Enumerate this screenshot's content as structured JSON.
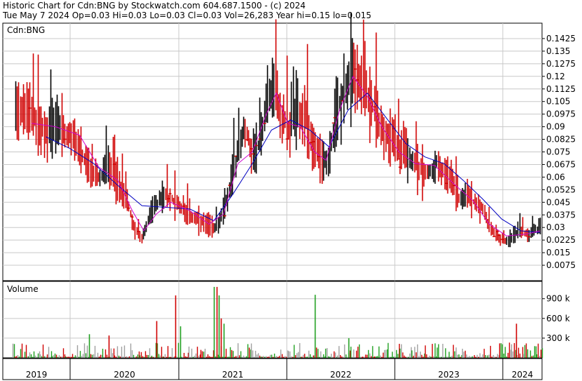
{
  "header": {
    "line1": "Historic Chart for Cdn:BNG by Stockwatch.com 604.687.1500 - (c) 2024",
    "line2": "Tue May  7 2024  Op=0.03  Hi=0.03  Lo=0.03  Cl=0.03  Vol=26,283  Year hi=0.15  lo=0.015"
  },
  "chart_data": [
    {
      "type": "bar",
      "title": "Cdn:BNG",
      "subtype": "price-range-bars-with-moving-averages",
      "x_categories": [
        "2019",
        "2020",
        "2021",
        "2022",
        "2023",
        "2024"
      ],
      "ylim": [
        0,
        0.15
      ],
      "y_ticks": [
        "0.0075",
        "0.015",
        "0.0225",
        "0.03",
        "0.0375",
        "0.045",
        "0.0525",
        "0.06",
        "0.0675",
        "0.075",
        "0.0825",
        "0.09",
        "0.0975",
        "0.105",
        "0.1125",
        "0.12",
        "0.1275",
        "0.135",
        "0.1425"
      ],
      "grid": true,
      "price_path": [
        {
          "t": 2018.88,
          "p": 0.105
        },
        {
          "t": 2019.05,
          "p": 0.095
        },
        {
          "t": 2019.2,
          "p": 0.088
        },
        {
          "t": 2019.35,
          "p": 0.09
        },
        {
          "t": 2019.5,
          "p": 0.082
        },
        {
          "t": 2019.6,
          "p": 0.07
        },
        {
          "t": 2019.75,
          "p": 0.06
        },
        {
          "t": 2019.85,
          "p": 0.065
        },
        {
          "t": 2019.97,
          "p": 0.055
        },
        {
          "t": 2020.05,
          "p": 0.045
        },
        {
          "t": 2020.12,
          "p": 0.028
        },
        {
          "t": 2020.2,
          "p": 0.024
        },
        {
          "t": 2020.3,
          "p": 0.04
        },
        {
          "t": 2020.42,
          "p": 0.05
        },
        {
          "t": 2020.55,
          "p": 0.045
        },
        {
          "t": 2020.65,
          "p": 0.04
        },
        {
          "t": 2020.75,
          "p": 0.035
        },
        {
          "t": 2020.85,
          "p": 0.032
        },
        {
          "t": 2020.95,
          "p": 0.03
        },
        {
          "t": 2021.02,
          "p": 0.035
        },
        {
          "t": 2021.1,
          "p": 0.05
        },
        {
          "t": 2021.18,
          "p": 0.07
        },
        {
          "t": 2021.26,
          "p": 0.09
        },
        {
          "t": 2021.34,
          "p": 0.075
        },
        {
          "t": 2021.42,
          "p": 0.08
        },
        {
          "t": 2021.5,
          "p": 0.105
        },
        {
          "t": 2021.58,
          "p": 0.115
        },
        {
          "t": 2021.66,
          "p": 0.095
        },
        {
          "t": 2021.74,
          "p": 0.088
        },
        {
          "t": 2021.82,
          "p": 0.098
        },
        {
          "t": 2021.9,
          "p": 0.095
        },
        {
          "t": 2021.98,
          "p": 0.08
        },
        {
          "t": 2022.06,
          "p": 0.068
        },
        {
          "t": 2022.14,
          "p": 0.07
        },
        {
          "t": 2022.22,
          "p": 0.1
        },
        {
          "t": 2022.3,
          "p": 0.11
        },
        {
          "t": 2022.38,
          "p": 0.125
        },
        {
          "t": 2022.46,
          "p": 0.118
        },
        {
          "t": 2022.54,
          "p": 0.11
        },
        {
          "t": 2022.62,
          "p": 0.1
        },
        {
          "t": 2022.7,
          "p": 0.09
        },
        {
          "t": 2022.78,
          "p": 0.085
        },
        {
          "t": 2022.86,
          "p": 0.078
        },
        {
          "t": 2022.94,
          "p": 0.068
        },
        {
          "t": 2023.02,
          "p": 0.07
        },
        {
          "t": 2023.1,
          "p": 0.065
        },
        {
          "t": 2023.18,
          "p": 0.062
        },
        {
          "t": 2023.26,
          "p": 0.068
        },
        {
          "t": 2023.34,
          "p": 0.064
        },
        {
          "t": 2023.42,
          "p": 0.058
        },
        {
          "t": 2023.5,
          "p": 0.048
        },
        {
          "t": 2023.58,
          "p": 0.05
        },
        {
          "t": 2023.66,
          "p": 0.045
        },
        {
          "t": 2023.74,
          "p": 0.042
        },
        {
          "t": 2023.82,
          "p": 0.03
        },
        {
          "t": 2023.9,
          "p": 0.025
        },
        {
          "t": 2023.98,
          "p": 0.022
        },
        {
          "t": 2024.06,
          "p": 0.025
        },
        {
          "t": 2024.14,
          "p": 0.028
        },
        {
          "t": 2024.22,
          "p": 0.025
        },
        {
          "t": 2024.3,
          "p": 0.028
        },
        {
          "t": 2024.35,
          "p": 0.03
        }
      ],
      "ma_short": [
        {
          "t": 2019.05,
          "p": 0.092
        },
        {
          "t": 2019.3,
          "p": 0.09
        },
        {
          "t": 2019.55,
          "p": 0.085
        },
        {
          "t": 2019.75,
          "p": 0.066
        },
        {
          "t": 2019.95,
          "p": 0.058
        },
        {
          "t": 2020.1,
          "p": 0.04
        },
        {
          "t": 2020.22,
          "p": 0.028
        },
        {
          "t": 2020.35,
          "p": 0.038
        },
        {
          "t": 2020.5,
          "p": 0.045
        },
        {
          "t": 2020.7,
          "p": 0.04
        },
        {
          "t": 2020.9,
          "p": 0.032
        },
        {
          "t": 2021.05,
          "p": 0.038
        },
        {
          "t": 2021.2,
          "p": 0.068
        },
        {
          "t": 2021.35,
          "p": 0.075
        },
        {
          "t": 2021.5,
          "p": 0.098
        },
        {
          "t": 2021.6,
          "p": 0.11
        },
        {
          "t": 2021.72,
          "p": 0.092
        },
        {
          "t": 2021.85,
          "p": 0.09
        },
        {
          "t": 2022.0,
          "p": 0.075
        },
        {
          "t": 2022.12,
          "p": 0.07
        },
        {
          "t": 2022.26,
          "p": 0.1
        },
        {
          "t": 2022.4,
          "p": 0.12
        },
        {
          "t": 2022.55,
          "p": 0.108
        },
        {
          "t": 2022.7,
          "p": 0.09
        },
        {
          "t": 2022.88,
          "p": 0.075
        },
        {
          "t": 2023.05,
          "p": 0.068
        },
        {
          "t": 2023.25,
          "p": 0.067
        },
        {
          "t": 2023.45,
          "p": 0.056
        },
        {
          "t": 2023.65,
          "p": 0.046
        },
        {
          "t": 2023.82,
          "p": 0.032
        },
        {
          "t": 2024.0,
          "p": 0.025
        },
        {
          "t": 2024.2,
          "p": 0.026
        },
        {
          "t": 2024.35,
          "p": 0.028
        }
      ],
      "ma_long": [
        {
          "t": 2019.2,
          "p": 0.084
        },
        {
          "t": 2019.45,
          "p": 0.077
        },
        {
          "t": 2019.7,
          "p": 0.068
        },
        {
          "t": 2019.95,
          "p": 0.055
        },
        {
          "t": 2020.2,
          "p": 0.043
        },
        {
          "t": 2020.45,
          "p": 0.042
        },
        {
          "t": 2020.7,
          "p": 0.041
        },
        {
          "t": 2020.95,
          "p": 0.034
        },
        {
          "t": 2021.15,
          "p": 0.05
        },
        {
          "t": 2021.35,
          "p": 0.068
        },
        {
          "t": 2021.55,
          "p": 0.088
        },
        {
          "t": 2021.75,
          "p": 0.094
        },
        {
          "t": 2021.95,
          "p": 0.088
        },
        {
          "t": 2022.15,
          "p": 0.078
        },
        {
          "t": 2022.35,
          "p": 0.1
        },
        {
          "t": 2022.55,
          "p": 0.11
        },
        {
          "t": 2022.75,
          "p": 0.095
        },
        {
          "t": 2022.95,
          "p": 0.08
        },
        {
          "t": 2023.15,
          "p": 0.072
        },
        {
          "t": 2023.35,
          "p": 0.068
        },
        {
          "t": 2023.55,
          "p": 0.058
        },
        {
          "t": 2023.75,
          "p": 0.047
        },
        {
          "t": 2023.95,
          "p": 0.035
        },
        {
          "t": 2024.15,
          "p": 0.028
        },
        {
          "t": 2024.35,
          "p": 0.027
        }
      ],
      "colors": {
        "up": "#000000",
        "down": "#d00000",
        "ma_short": "#d000d0",
        "ma_long": "#0000c0",
        "grid": "#c8c8c8"
      }
    },
    {
      "type": "bar",
      "title": "Volume",
      "ylim": [
        0,
        1100000
      ],
      "y_ticks": [
        "300 k",
        "600 k",
        "900 k"
      ],
      "spikes": [
        {
          "t": 2020.95,
          "v": 1080000
        },
        {
          "t": 2020.98,
          "v": 1080000
        },
        {
          "t": 2021.0,
          "v": 950000
        },
        {
          "t": 2020.55,
          "v": 950000
        },
        {
          "t": 2022.0,
          "v": 960000
        },
        {
          "t": 2020.35,
          "v": 560000
        },
        {
          "t": 2020.6,
          "v": 480000
        },
        {
          "t": 2021.02,
          "v": 600000
        },
        {
          "t": 2021.05,
          "v": 520000
        },
        {
          "t": 2024.1,
          "v": 520000
        },
        {
          "t": 2019.65,
          "v": 360000
        },
        {
          "t": 2019.85,
          "v": 340000
        },
        {
          "t": 2022.35,
          "v": 300000
        }
      ],
      "colors": {
        "up": "#20a020",
        "down": "#d00000",
        "neutral": "#a0a0a0"
      }
    }
  ]
}
